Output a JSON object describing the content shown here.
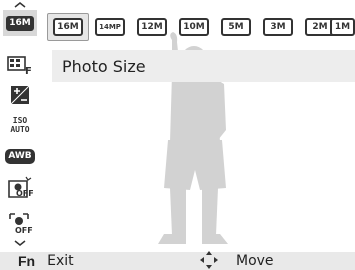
{
  "left_menu": {
    "items": [
      {
        "icon": "photo-size-16m-icon",
        "text": "16M"
      },
      {
        "icon": "quality-icon",
        "text": "F"
      },
      {
        "icon": "exposure-icon",
        "text": "+/-"
      },
      {
        "icon": "iso-auto-icon",
        "text": "ISO AUTO"
      },
      {
        "icon": "white-balance-icon",
        "text": "AWB"
      },
      {
        "icon": "face-detection-off-icon",
        "text": "OFF"
      },
      {
        "icon": "smart-face-off-icon",
        "text": "OFF"
      }
    ]
  },
  "size_options": [
    {
      "label": "16M",
      "selected": true
    },
    {
      "label": "14MP",
      "selected": false
    },
    {
      "label": "12M",
      "selected": false
    },
    {
      "label": "10M",
      "selected": false
    },
    {
      "label": "5M",
      "selected": false
    },
    {
      "label": "3M",
      "selected": false
    },
    {
      "label": "2M",
      "selected": false
    },
    {
      "label": "1M",
      "selected": false
    }
  ],
  "title": "Photo Size",
  "bottom_bar": {
    "fn_key": "Fn",
    "exit_label": "Exit",
    "move_label": "Move"
  }
}
